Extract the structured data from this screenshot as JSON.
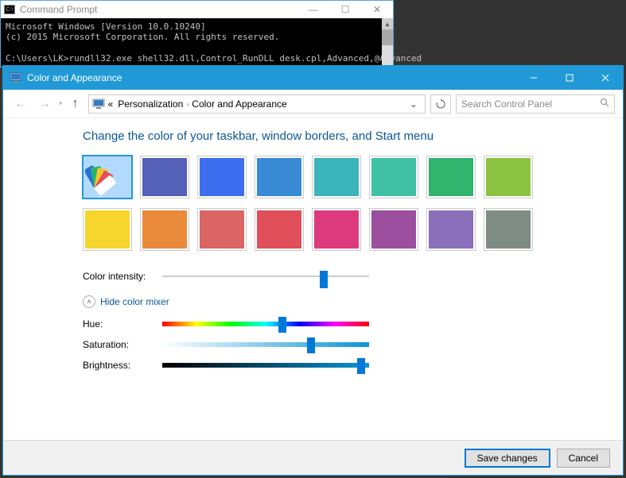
{
  "cmd": {
    "title": "Command Prompt",
    "line1": "Microsoft Windows [Version 10.0.10240]",
    "line2": "(c) 2015 Microsoft Corporation. All rights reserved.",
    "prompt": "C:\\Users\\LK>rundll32.exe shell32.dll,Control_RunDLL desk.cpl,Advanced,@Advanced"
  },
  "window": {
    "title": "Color and Appearance"
  },
  "breadcrumb": {
    "back_label": "«",
    "parent": "Personalization",
    "current": "Color and Appearance"
  },
  "search": {
    "placeholder": "Search Control Panel"
  },
  "heading": "Change the color of your taskbar, window borders, and Start menu",
  "swatches": [
    {
      "color": "#b3d9ff",
      "selected": true,
      "auto": true
    },
    {
      "color": "#5560b8"
    },
    {
      "color": "#3e6ef0"
    },
    {
      "color": "#3a8bd6"
    },
    {
      "color": "#3cb4bb"
    },
    {
      "color": "#40c0a5"
    },
    {
      "color": "#32b36e"
    },
    {
      "color": "#8cc341"
    },
    {
      "color": "#f6d52c"
    },
    {
      "color": "#ea8a3b"
    },
    {
      "color": "#db6564"
    },
    {
      "color": "#e14f5a"
    },
    {
      "color": "#dd3a7d"
    },
    {
      "color": "#9b4f9e"
    },
    {
      "color": "#8a6fba"
    },
    {
      "color": "#7f8c85"
    }
  ],
  "sliders": {
    "intensity": {
      "label": "Color intensity:",
      "value": 0.78
    },
    "mixer_toggle": "Hide color mixer",
    "hue": {
      "label": "Hue:",
      "value": 0.58
    },
    "saturation": {
      "label": "Saturation:",
      "value": 0.72
    },
    "brightness": {
      "label": "Brightness:",
      "value": 0.96
    }
  },
  "footer": {
    "save": "Save changes",
    "cancel": "Cancel"
  }
}
